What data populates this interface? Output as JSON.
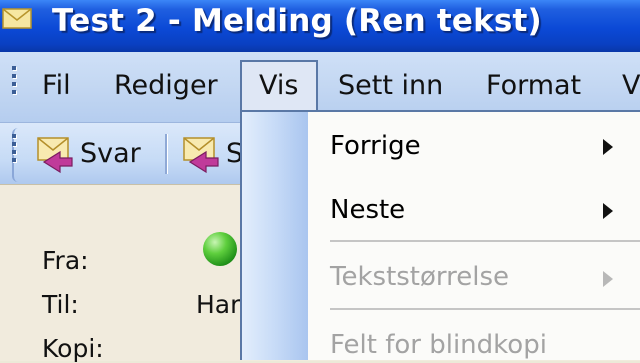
{
  "window": {
    "title": "Test 2 - Melding (Ren tekst)"
  },
  "menubar": {
    "items": [
      {
        "label": "Fil"
      },
      {
        "label": "Rediger"
      },
      {
        "label": "Vis"
      },
      {
        "label": "Sett inn"
      },
      {
        "label": "Format"
      },
      {
        "label": "V"
      }
    ]
  },
  "toolbar": {
    "reply_label": "Svar",
    "reply_all_partial": "S"
  },
  "header": {
    "from_label": "Fra:",
    "to_label": "Til:",
    "to_value_partial": "Har",
    "cc_label": "Kopi:"
  },
  "view_menu": {
    "items": [
      {
        "label": "Forrige",
        "enabled": true,
        "submenu": true
      },
      {
        "label": "Neste",
        "enabled": true,
        "submenu": true
      },
      {
        "label": "Tekststørrelse",
        "enabled": false,
        "submenu": true
      },
      {
        "label": "Felt for blindkopi",
        "enabled": false,
        "submenu": false
      }
    ]
  },
  "icons": {
    "title": "envelope-icon",
    "reply": "reply-icon",
    "reply_all": "reply-all-icon",
    "presence": "presence-online-icon",
    "submenu": "submenu-arrow-icon"
  },
  "colors": {
    "titlebar": "#0b49d6",
    "menubar": "#c3d7f2",
    "menu_open_border": "#5a78a6",
    "disabled_text": "#a3a3a3",
    "presence_online": "#3fb12a"
  }
}
